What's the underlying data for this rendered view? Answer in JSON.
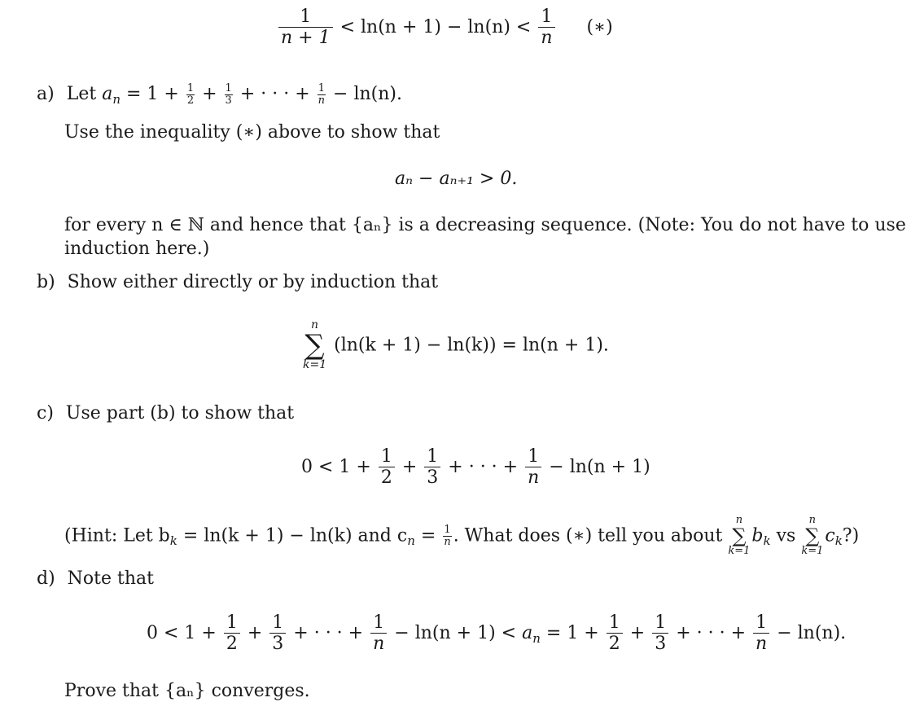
{
  "header_inequality": {
    "left_num": "1",
    "left_den": "n + 1",
    "middle": "< ln(n + 1) − ln(n) <",
    "right_num": "1",
    "right_den": "n",
    "tag": "(∗)"
  },
  "part_a": {
    "label": "a)",
    "intro": "Let",
    "an_def_lhs": "a",
    "an_def_sub": "n",
    "an_def_rhs_start": "= 1 +",
    "f2_num": "1",
    "f2_den": "2",
    "f3_num": "1",
    "f3_den": "3",
    "dots": "+ · · · +",
    "fn_num": "1",
    "fn_den": "n",
    "an_def_end": "− ln(n).",
    "instruction": "Use the inequality (∗) above to show that",
    "display_eq": "aₙ − aₙ₊₁ > 0.",
    "followup_line1": "for every n ∈ ℕ and hence that {aₙ} is a decreasing sequence. (Note: You do not have to use",
    "followup_line2": "induction here.)"
  },
  "part_b": {
    "label": "b)",
    "instruction": "Show either directly or by induction that",
    "sum_top": "n",
    "sum_bot": "k=1",
    "sum_body": "(ln(k + 1) − ln(k)) = ln(n + 1)."
  },
  "part_c": {
    "label": "c)",
    "instruction": "Use part (b) to show that",
    "ineq_start": "0 < 1 +",
    "f2_num": "1",
    "f2_den": "2",
    "plus": "+",
    "f3_num": "1",
    "f3_den": "3",
    "dots": "+ · · · +",
    "fn_num": "1",
    "fn_den": "n",
    "ineq_end": "− ln(n + 1)",
    "hint_start": "(Hint: Let b",
    "hint_bk_sub": "k",
    "hint_mid": "= ln(k + 1) − ln(k) and c",
    "hint_cn_sub": "n",
    "hint_eq": "=",
    "hint_frac_num": "1",
    "hint_frac_den": "n",
    "hint_question": ". What does (∗) tell you about",
    "sum_top": "n",
    "sum_bot": "k=1",
    "b_term": "b",
    "b_sub": "k",
    "vs": "vs",
    "c_term": "c",
    "c_sub": "k",
    "hint_end": "?)"
  },
  "part_d": {
    "label": "d)",
    "instruction": "Note that",
    "ineq_start": "0 < 1 +",
    "f2_num": "1",
    "f2_den": "2",
    "plus": "+",
    "f3_num": "1",
    "f3_den": "3",
    "dots": "+ · · · +",
    "fn_num": "1",
    "fn_den": "n",
    "mid": "− ln(n + 1) <",
    "an": "a",
    "an_sub": "n",
    "eq_start": "= 1 +",
    "end": "− ln(n).",
    "conclusion": "Prove that {aₙ} converges."
  }
}
